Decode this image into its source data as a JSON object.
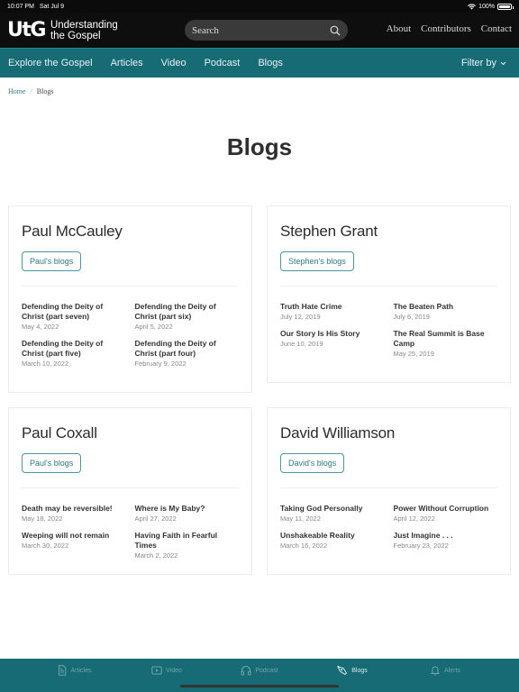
{
  "status_bar": {
    "time": "10:07 PM",
    "date": "Sat Jul 9",
    "battery": "100%"
  },
  "header": {
    "logo_mark": "UtG",
    "logo_line1": "Understanding",
    "logo_line2": "the Gospel",
    "search_placeholder": "Search",
    "links": [
      "About",
      "Contributors",
      "Contact"
    ]
  },
  "nav": {
    "items": [
      "Explore the Gospel",
      "Articles",
      "Video",
      "Podcast",
      "Blogs"
    ],
    "filter_label": "Filter by"
  },
  "breadcrumb": {
    "home": "Home",
    "separator": "/",
    "current": "Blogs"
  },
  "page_title": "Blogs",
  "authors": [
    {
      "name": "Paul McCauley",
      "button": "Paul's blogs",
      "posts": [
        {
          "title": "Defending the Deity of Christ (part seven)",
          "date": "May 4, 2022"
        },
        {
          "title": "Defending the Deity of Christ (part six)",
          "date": "April 5, 2022"
        },
        {
          "title": "Defending the Deity of Christ (part five)",
          "date": "March 10, 2022"
        },
        {
          "title": "Defending the Deity of Christ (part four)",
          "date": "February 9, 2022"
        }
      ]
    },
    {
      "name": "Stephen Grant",
      "button": "Stephen's blogs",
      "posts": [
        {
          "title": "Truth Hate Crime",
          "date": "July 12, 2019"
        },
        {
          "title": "The Beaten Path",
          "date": "July 6, 2019"
        },
        {
          "title": "Our Story Is His Story",
          "date": "June 10, 2019"
        },
        {
          "title": "The Real Summit is Base Camp",
          "date": "May 25, 2019"
        }
      ]
    },
    {
      "name": "Paul Coxall",
      "button": "Paul's blogs",
      "posts": [
        {
          "title": "Death may be reversible!",
          "date": "May 18, 2022"
        },
        {
          "title": "Where is My Baby?",
          "date": "April 27, 2022"
        },
        {
          "title": "Weeping will not remain",
          "date": "March 30, 2022"
        },
        {
          "title": "Having Faith in Fearful Times",
          "date": "March 2, 2022"
        }
      ]
    },
    {
      "name": "David Williamson",
      "button": "David's blogs",
      "posts": [
        {
          "title": "Taking God Personally",
          "date": "May 11, 2022"
        },
        {
          "title": "Power Without Corruption",
          "date": "April 12, 2022"
        },
        {
          "title": "Unshakeable Reality",
          "date": "March 16, 2022"
        },
        {
          "title": "Just Imagine . . .",
          "date": "February 23, 2022"
        }
      ]
    }
  ],
  "tab_bar": {
    "tabs": [
      {
        "label": "Articles",
        "icon": "document-icon",
        "active": false
      },
      {
        "label": "Video",
        "icon": "play-icon",
        "active": false
      },
      {
        "label": "Podcast",
        "icon": "headphones-icon",
        "active": false
      },
      {
        "label": "Blogs",
        "icon": "pen-nib-icon",
        "active": true
      },
      {
        "label": "Alerts",
        "icon": "bell-icon",
        "active": false
      }
    ]
  },
  "colors": {
    "brand_teal": "#176b75",
    "header_black": "#0e0e0e",
    "link_teal": "#2d7b84"
  }
}
